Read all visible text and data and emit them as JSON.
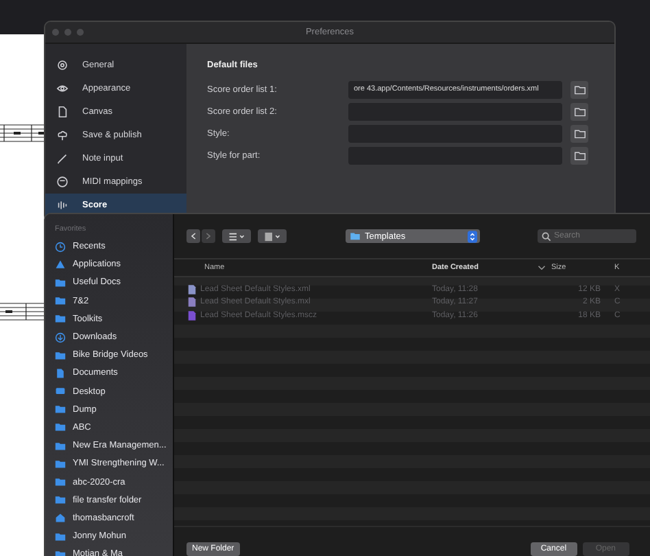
{
  "preferences": {
    "title": "Preferences",
    "sidebar": [
      {
        "label": "General",
        "selected": false
      },
      {
        "label": "Appearance",
        "selected": false
      },
      {
        "label": "Canvas",
        "selected": false
      },
      {
        "label": "Save & publish",
        "selected": false
      },
      {
        "label": "Note input",
        "selected": false
      },
      {
        "label": "MIDI mappings",
        "selected": false
      },
      {
        "label": "Score",
        "selected": true
      }
    ],
    "section_title": "Default files",
    "fields": [
      {
        "label": "Score order list 1:",
        "value": "ore 43.app/Contents/Resources/instruments/orders.xml"
      },
      {
        "label": "Score order list 2:"
      },
      {
        "label": "Style:"
      },
      {
        "label": "Style for part:"
      }
    ]
  },
  "open_dialog": {
    "sidebar_header": "Favorites",
    "sidebar": [
      {
        "label": "Recents",
        "selected": false
      },
      {
        "label": "Applications",
        "selected": false
      },
      {
        "label": "Useful Docs",
        "selected": false
      },
      {
        "label": "7&2",
        "selected": false
      },
      {
        "label": "Toolkits",
        "selected": false
      },
      {
        "label": "Downloads",
        "selected": false
      },
      {
        "label": "Bike Bridge Videos",
        "selected": false
      },
      {
        "label": "Documents",
        "selected": false
      },
      {
        "label": "Desktop",
        "selected": false
      },
      {
        "label": "Dump",
        "selected": false
      },
      {
        "label": "ABC",
        "selected": false
      },
      {
        "label": "New Era Managemen...",
        "selected": false
      },
      {
        "label": "YMI Strengthening W...",
        "selected": false
      },
      {
        "label": "abc-2020-cra",
        "selected": false
      },
      {
        "label": "file transfer folder",
        "selected": false
      },
      {
        "label": "thomasbancroft",
        "selected": false
      },
      {
        "label": "Jonny Mohun",
        "selected": false
      },
      {
        "label": "Motian & Ma",
        "selected": false
      }
    ],
    "location": "Templates",
    "search": {
      "placeholder": "Search"
    },
    "columns": [
      {
        "label": "Name",
        "sorted": false
      },
      {
        "label": "Date Created",
        "sorted": true
      },
      {
        "label": "Size",
        "sorted": false
      },
      {
        "label": "K",
        "sorted": false
      }
    ],
    "rows": [
      {
        "name": "Lead Sheet Default Styles.xml",
        "date": "Today, 11:28",
        "size": "12 KB",
        "column_4": "X",
        "disabled": true
      },
      {
        "name": "Lead Sheet Default Styles.mxl",
        "date": "Today, 11:27",
        "size": "2 KB",
        "column_4": "C",
        "disabled": true
      },
      {
        "name": "Lead Sheet Default Styles.mscz",
        "date": "Today, 11:26",
        "size": "18 KB",
        "column_4": "C",
        "disabled": true
      }
    ],
    "buttons": [
      {
        "label": "New Folder",
        "disabled": false
      },
      {
        "label": "Cancel",
        "disabled": false
      },
      {
        "label": "Open",
        "disabled": true
      }
    ]
  }
}
